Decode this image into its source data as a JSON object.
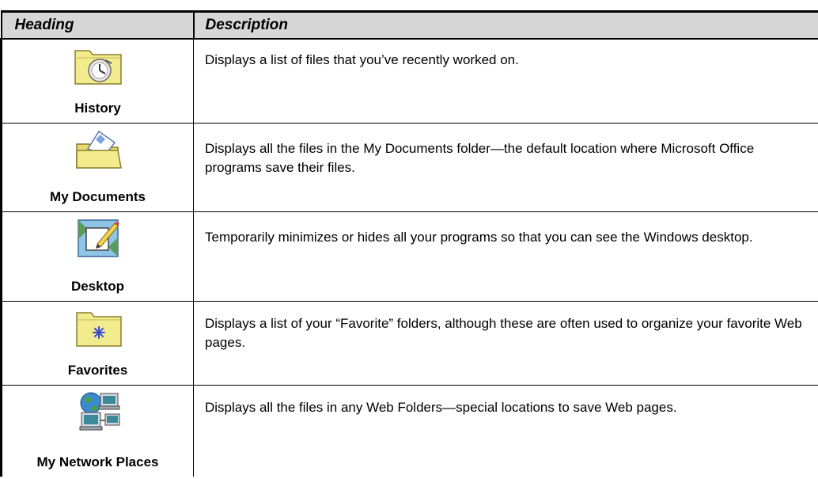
{
  "table": {
    "columns": {
      "heading": "Heading",
      "description": "Description"
    },
    "rows": [
      {
        "label": "History",
        "icon": "history-icon",
        "description": "Displays a list of files that you’ve recently worked on."
      },
      {
        "label": "My Documents",
        "icon": "my-documents-icon",
        "description": "Displays all the files in the My Documents folder—the default location where Microsoft Office programs save their files."
      },
      {
        "label": "Desktop",
        "icon": "desktop-icon",
        "description": "Temporarily minimizes or hides all your programs so that you can see the Windows desktop."
      },
      {
        "label": "Favorites",
        "icon": "favorites-icon",
        "description": "Displays a list of your “Favorite” folders, although these are often used to organize your favorite Web pages."
      },
      {
        "label": "My Network Places",
        "icon": "my-network-places-icon",
        "description": "Displays all the files in any Web Folders—special locations to save Web pages."
      }
    ]
  },
  "colors": {
    "header_bg": "#d7d7d7",
    "folder_yellow": "#f3ec8e",
    "border": "#000000"
  }
}
